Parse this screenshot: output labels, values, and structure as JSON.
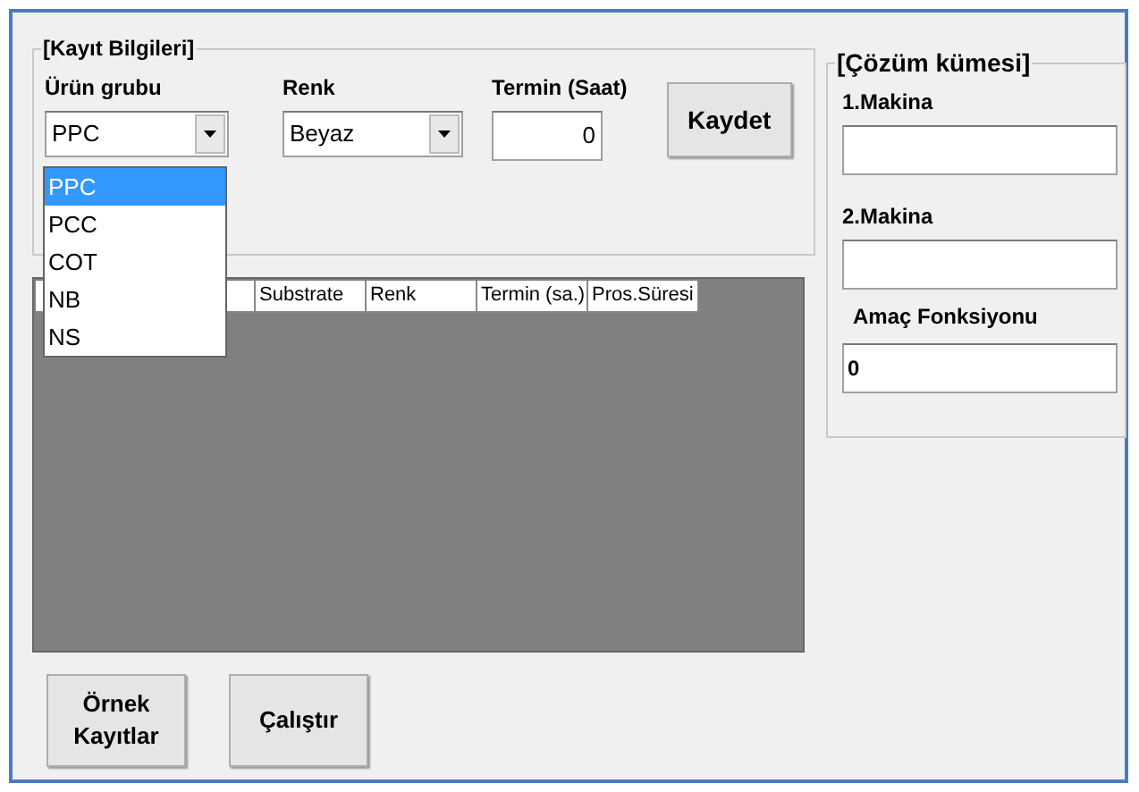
{
  "record_group": {
    "title": "[Kayıt Bilgileri]",
    "product_group": {
      "label": "Ürün grubu",
      "value": "PPC",
      "expanded": true,
      "options": [
        {
          "label": "PPC",
          "selected": true
        },
        {
          "label": "PCC",
          "selected": false
        },
        {
          "label": "COT",
          "selected": false
        },
        {
          "label": "NB",
          "selected": false
        },
        {
          "label": "NS",
          "selected": false
        }
      ]
    },
    "color": {
      "label": "Renk",
      "value": "Beyaz"
    },
    "deadline": {
      "label": "Termin (Saat)",
      "value": "0"
    },
    "save_button": "Kaydet"
  },
  "table": {
    "columns": [
      "",
      "Substrate",
      "Renk",
      "Termin (sa.)",
      "Pros.Süresi"
    ]
  },
  "solution_group": {
    "title": "[Çözüm kümesi]",
    "machine_1": {
      "label": "1.Makina"
    },
    "machine_2": {
      "label": "2.Makina"
    },
    "objective": {
      "label": "Amaç Fonksiyonu",
      "value": "0"
    }
  },
  "buttons": [
    "Örnek Kayıtlar",
    "Çalıştır"
  ]
}
